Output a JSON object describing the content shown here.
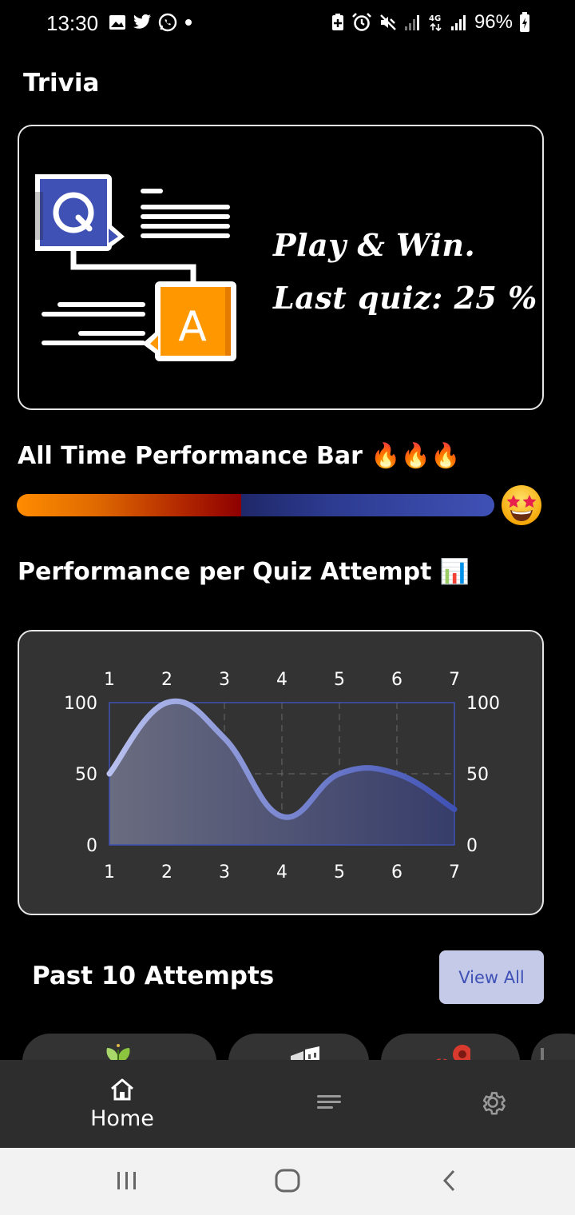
{
  "status_bar": {
    "time": "13:30",
    "battery": "96%",
    "left_icons": [
      "image-icon",
      "twitter-icon",
      "whatsapp-icon",
      "dot-icon"
    ],
    "right_icons": [
      "battery-saver-icon",
      "alarm-icon",
      "mute-icon",
      "signal-icon",
      "4g-icon",
      "signal-icon",
      "battery-charging-icon"
    ]
  },
  "app": {
    "title": "Trivia"
  },
  "hero": {
    "line1": "Play & Win.",
    "line2": "Last quiz: 25 %",
    "illustration_letters": {
      "question": "Q",
      "answer": "A"
    },
    "colors": {
      "question": "#3f51b5",
      "answer": "#ff9800"
    }
  },
  "performance_bar": {
    "heading": "All Time Performance Bar 🔥🔥🔥",
    "level": 0.47,
    "emoji": "🤩",
    "colors": {
      "fill_start": "#ff8c00",
      "fill_end": "#8e0000",
      "track_end": "#3f51b5"
    }
  },
  "performance_chart": {
    "heading": "Performance per Quiz Attempt 📊"
  },
  "chart_data": {
    "type": "area",
    "x": [
      1,
      2,
      3,
      4,
      5,
      6,
      7
    ],
    "values": [
      50,
      100,
      75,
      20,
      50,
      50,
      25
    ],
    "xlim": [
      1,
      7
    ],
    "ylim": [
      0,
      100
    ],
    "x_ticks": [
      "1",
      "2",
      "3",
      "4",
      "5",
      "6",
      "7"
    ],
    "y_ticks": [
      "0",
      "50",
      "100"
    ],
    "grid": true,
    "line_color_start": "#b8c0ee",
    "line_color_end": "#3f51b5"
  },
  "past_attempts": {
    "heading": "Past 10 Attempts",
    "view_all_label": "View All",
    "chips": [
      "plant-icon",
      "building-icon",
      "map-pin-icon",
      "item-icon"
    ]
  },
  "bottom_nav": {
    "items": [
      {
        "label": "Home",
        "icon": "home-icon"
      },
      {
        "label": "",
        "icon": "menu-icon"
      },
      {
        "label": "",
        "icon": "settings-icon"
      }
    ]
  },
  "system_nav": [
    "recent-apps-icon",
    "home-circle-icon",
    "back-icon"
  ]
}
